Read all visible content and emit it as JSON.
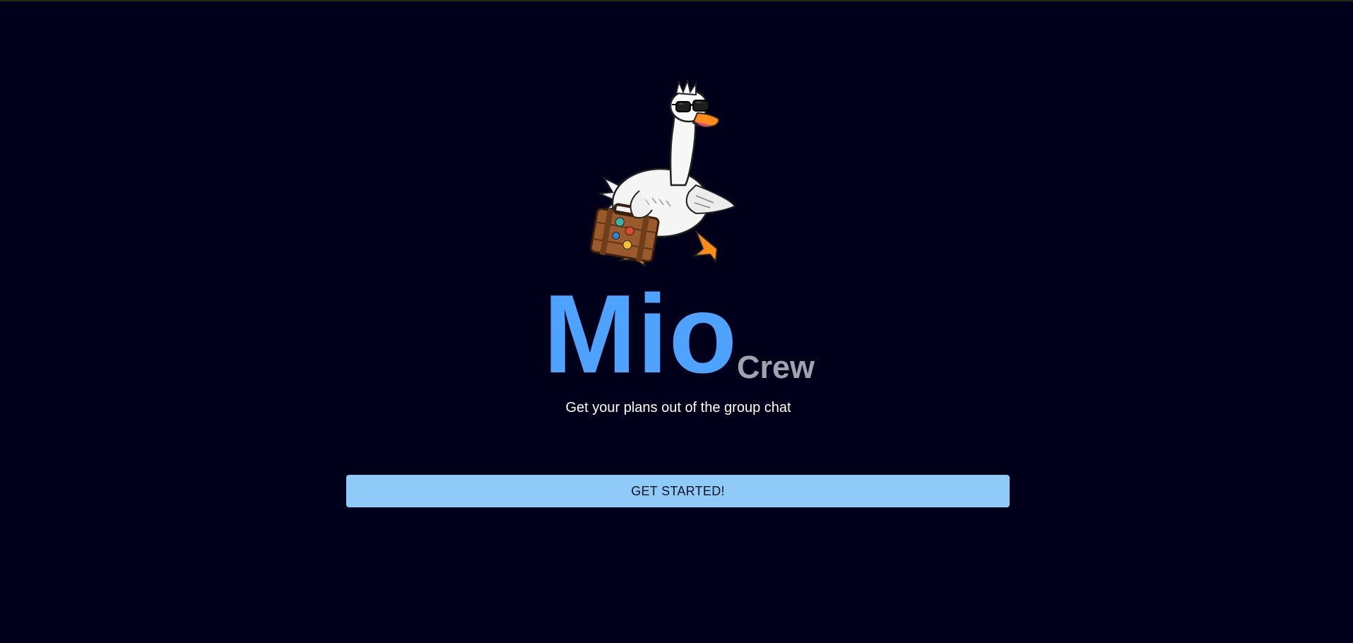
{
  "brand": {
    "name": "Mio",
    "suffix": "Crew",
    "tagline": "Get your plans out of the group chat"
  },
  "hero": {
    "mascot_icon": "goose-with-sunglasses-and-suitcase-icon"
  },
  "cta": {
    "label": "GET STARTED!"
  },
  "colors": {
    "background": "#00001a",
    "brand_blue": "#4da3ff",
    "suffix_gray": "#a0a3ad",
    "button_bg": "#90caf9"
  }
}
